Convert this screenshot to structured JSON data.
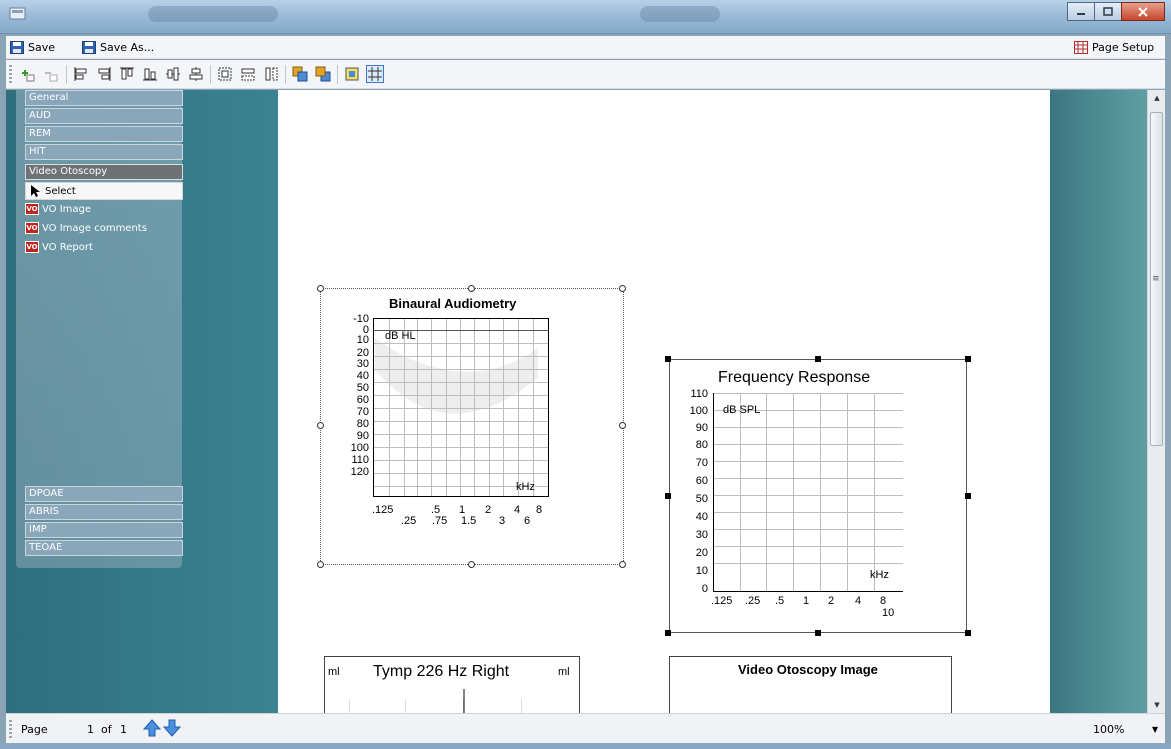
{
  "menu": {
    "save_label": "Save",
    "save_as_label": "Save As...",
    "page_setup_label": "Page Setup"
  },
  "toolbar": {
    "buttons": [
      "add-object",
      "remove-object",
      "align-left",
      "align-right",
      "align-top",
      "align-bottom",
      "center-horizontal",
      "center-vertical",
      "same-size",
      "same-width",
      "same-height",
      "bring-to-front",
      "send-to-back",
      "snap-to-grid",
      "show-grid"
    ]
  },
  "palette": {
    "categories_top": [
      "General",
      "AUD",
      "REM",
      "HIT",
      "Video Otoscopy"
    ],
    "selected_category": "Video Otoscopy",
    "select_label": "Select",
    "vo_badge": "VO",
    "vo_items": [
      "VO Image",
      "VO Image comments",
      "VO Report"
    ],
    "categories_bottom": [
      "DPOAE",
      "ABRIS",
      "IMP",
      "TEOAE"
    ]
  },
  "audiogram": {
    "title": "Binaural Audiometry",
    "y_unit": "dB HL",
    "x_unit": "kHz",
    "y_ticks": [
      "-10",
      "0",
      "10",
      "20",
      "30",
      "40",
      "50",
      "60",
      "70",
      "80",
      "90",
      "100",
      "110",
      "120"
    ],
    "x_ticks_top": [
      ".125",
      ".5",
      "1",
      "2",
      "4",
      "8"
    ],
    "x_ticks_bottom": [
      ".25",
      ".75",
      "1.5",
      "3",
      "6"
    ]
  },
  "freqresp": {
    "title": "Frequency Response",
    "y_unit": "dB SPL",
    "x_unit": "kHz",
    "y_ticks": [
      "110",
      "100",
      "90",
      "80",
      "70",
      "60",
      "50",
      "40",
      "30",
      "20",
      "10",
      "0"
    ],
    "x_ticks": [
      ".125",
      ".25",
      ".5",
      "1",
      "2",
      "4",
      "8"
    ],
    "x_tick_extra": "10"
  },
  "tymp": {
    "title": "Tymp 226 Hz Right",
    "left_unit": "ml",
    "right_unit": "ml"
  },
  "vo_image": {
    "title": "Video Otoscopy Image"
  },
  "status": {
    "page_label": "Page",
    "page_current": "1",
    "page_of": "of",
    "page_total": "1",
    "zoom": "100%"
  },
  "colors": {
    "workspace": "#3c8493",
    "palette_selected": "#6f7275",
    "vo_badge": "#c2241b",
    "accent": "#3b79c4"
  }
}
